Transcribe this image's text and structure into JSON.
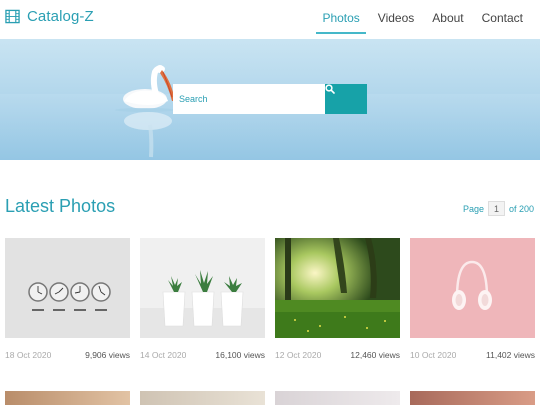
{
  "brand": {
    "name": "Catalog-Z"
  },
  "nav": [
    {
      "label": "Photos",
      "active": true
    },
    {
      "label": "Videos",
      "active": false
    },
    {
      "label": "About",
      "active": false
    },
    {
      "label": "Contact",
      "active": false
    }
  ],
  "search": {
    "placeholder": "Search"
  },
  "section": {
    "title": "Latest Photos"
  },
  "pager": {
    "prefix": "Page",
    "current": "1",
    "suffix": "of 200"
  },
  "photos": [
    {
      "date": "18 Oct 2020",
      "views": "9,906 views",
      "subject": "world clocks"
    },
    {
      "date": "14 Oct 2020",
      "views": "16,100 views",
      "subject": "potted succulents"
    },
    {
      "date": "12 Oct 2020",
      "views": "12,460 views",
      "subject": "sunlit forest meadow"
    },
    {
      "date": "10 Oct 2020",
      "views": "11,402 views",
      "subject": "white headphones on pink"
    }
  ],
  "colors": {
    "accent": "#2a9fb3",
    "button": "#17a2a8"
  }
}
